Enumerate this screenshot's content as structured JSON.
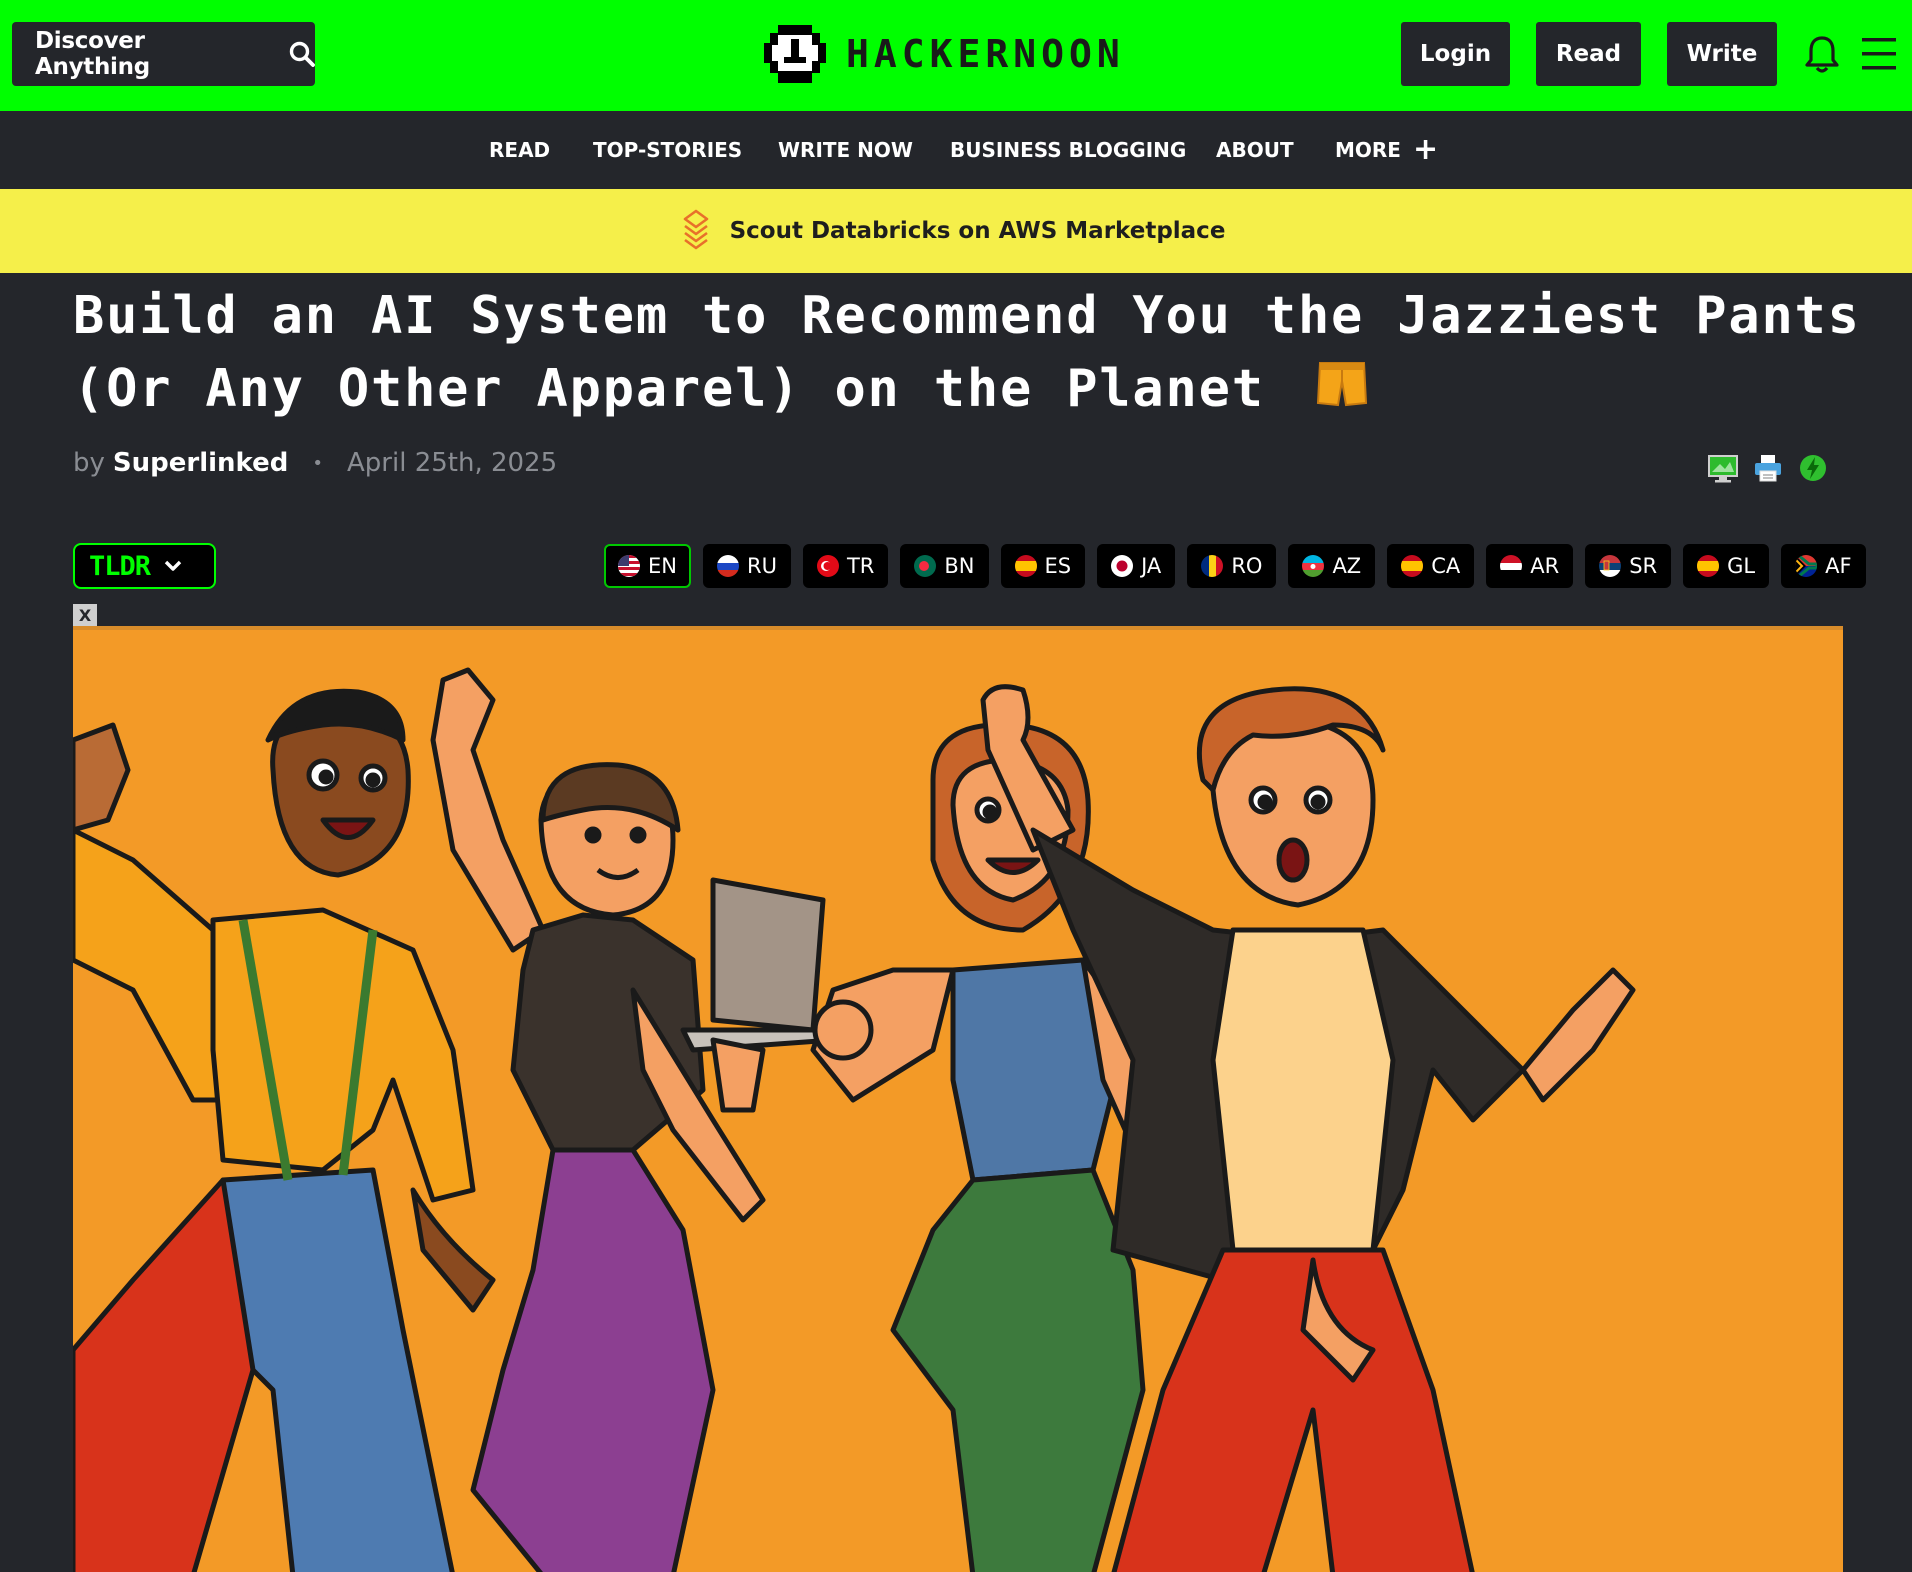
{
  "header": {
    "search_label": "Discover Anything",
    "logo_text": "HACKERNOON",
    "login_label": "Login",
    "read_label": "Read",
    "write_label": "Write"
  },
  "nav": {
    "items": [
      "READ",
      "TOP-STORIES",
      "WRITE NOW",
      "BUSINESS BLOGGING",
      "ABOUT",
      "MORE"
    ]
  },
  "banner": {
    "text": "Scout Databricks on AWS Marketplace"
  },
  "article": {
    "title_line1": "Build an AI System to Recommend You the Jazziest Pants",
    "title_line2": "(Or Any Other Apparel) on the Planet",
    "title_emoji": "🩳",
    "by": "by",
    "author": "Superlinked",
    "date": "April 25th, 2025"
  },
  "tldr": {
    "label": "TLDR"
  },
  "languages": [
    {
      "code": "EN",
      "active": true
    },
    {
      "code": "RU"
    },
    {
      "code": "TR"
    },
    {
      "code": "BN"
    },
    {
      "code": "ES"
    },
    {
      "code": "JA"
    },
    {
      "code": "RO"
    },
    {
      "code": "AZ"
    },
    {
      "code": "CA"
    },
    {
      "code": "AR"
    },
    {
      "code": "SR"
    },
    {
      "code": "GL"
    },
    {
      "code": "AF"
    }
  ],
  "close_label": "X",
  "colors": {
    "brand_green": "#00ff00",
    "dark": "#24262b",
    "banner": "#f5ef4a",
    "hero_bg": "#f39a27"
  }
}
